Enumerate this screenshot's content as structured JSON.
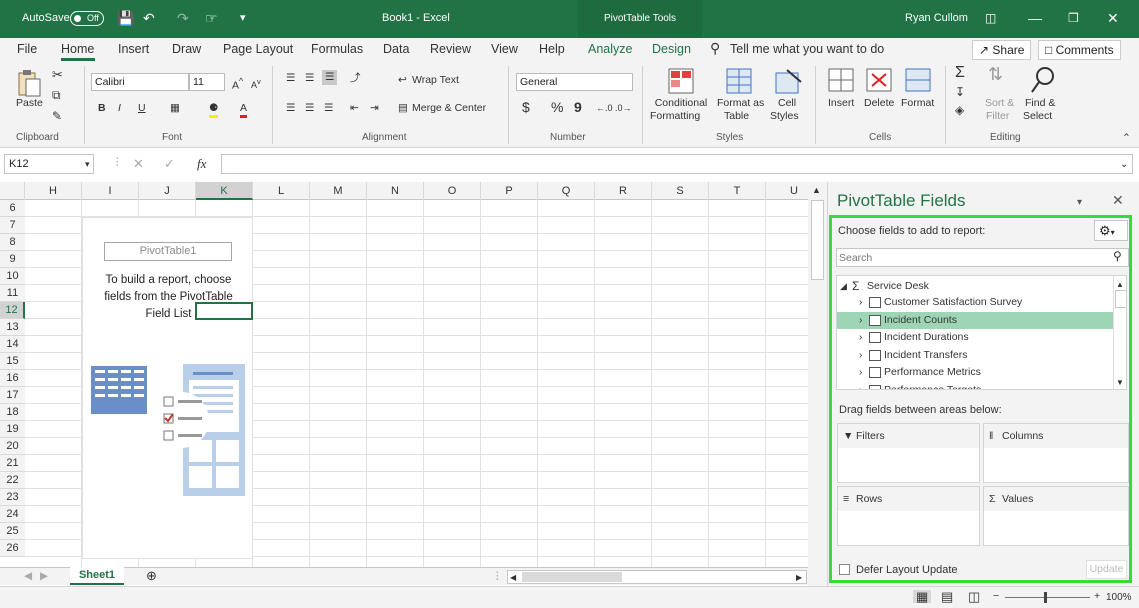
{
  "titlebar": {
    "autosave": "AutoSave",
    "toggle": "Off",
    "title": "Book1 - Excel",
    "context_tools": "PivotTable Tools",
    "user": "Ryan Cullom"
  },
  "tabs": {
    "file": "File",
    "home": "Home",
    "insert": "Insert",
    "draw": "Draw",
    "page_layout": "Page Layout",
    "formulas": "Formulas",
    "data": "Data",
    "review": "Review",
    "view": "View",
    "help": "Help",
    "analyze": "Analyze",
    "design": "Design",
    "tell_me": "Tell me what you want to do",
    "share": "Share",
    "comments": "Comments"
  },
  "ribbon": {
    "clipboard": {
      "paste": "Paste",
      "label": "Clipboard"
    },
    "font": {
      "name": "Calibri",
      "size": "11",
      "bold": "B",
      "italic": "I",
      "underline": "U",
      "label": "Font"
    },
    "alignment": {
      "wrap": "Wrap Text",
      "merge": "Merge & Center",
      "label": "Alignment"
    },
    "number": {
      "format": "General",
      "currency": "$",
      "percent": "%",
      "comma": "9",
      "label": "Number"
    },
    "styles": {
      "conditional": "Conditional",
      "formatting": "Formatting",
      "format_as": "Format as",
      "table": "Table",
      "cell": "Cell",
      "cell_styles": "Styles",
      "label": "Styles"
    },
    "cells": {
      "insert": "Insert",
      "delete": "Delete",
      "format": "Format",
      "label": "Cells"
    },
    "editing": {
      "sort": "Sort &",
      "filter": "Filter",
      "find": "Find &",
      "select": "Select",
      "label": "Editing"
    }
  },
  "formula": {
    "namebox": "K12",
    "fx": "fx",
    "value": ""
  },
  "grid": {
    "columns": [
      "H",
      "I",
      "J",
      "K",
      "L",
      "M",
      "N",
      "O",
      "P",
      "Q",
      "R",
      "S",
      "T",
      "U"
    ],
    "rows": [
      "6",
      "7",
      "8",
      "9",
      "10",
      "11",
      "12",
      "13",
      "14",
      "15",
      "16",
      "17",
      "18",
      "19",
      "20",
      "21",
      "22",
      "23",
      "24",
      "25",
      "26"
    ],
    "active_cell": "K12"
  },
  "pivot_placeholder": {
    "name": "PivotTable1",
    "message": "To build a report, choose fields from the PivotTable Field List"
  },
  "sheets": {
    "active": "Sheet1"
  },
  "status": {
    "zoom": "100%"
  },
  "panel": {
    "title": "PivotTable Fields",
    "choose": "Choose fields to add to report:",
    "search_placeholder": "Search",
    "root": "Service Desk",
    "fields": [
      {
        "label": "Customer Satisfaction Survey",
        "hovered": false
      },
      {
        "label": "Incident Counts",
        "hovered": true
      },
      {
        "label": "Incident Durations",
        "hovered": false
      },
      {
        "label": "Incident Transfers",
        "hovered": false
      },
      {
        "label": "Performance Metrics",
        "hovered": false
      },
      {
        "label": "Performance Targets",
        "hovered": false
      }
    ],
    "drag_label": "Drag fields between areas below:",
    "areas": {
      "filters": "Filters",
      "columns": "Columns",
      "rows": "Rows",
      "values": "Values"
    },
    "defer": "Defer Layout Update",
    "update": "Update"
  },
  "colors": {
    "accent": "#217346",
    "highlight": "#33dd33",
    "hover_row": "#9fd5b7"
  }
}
